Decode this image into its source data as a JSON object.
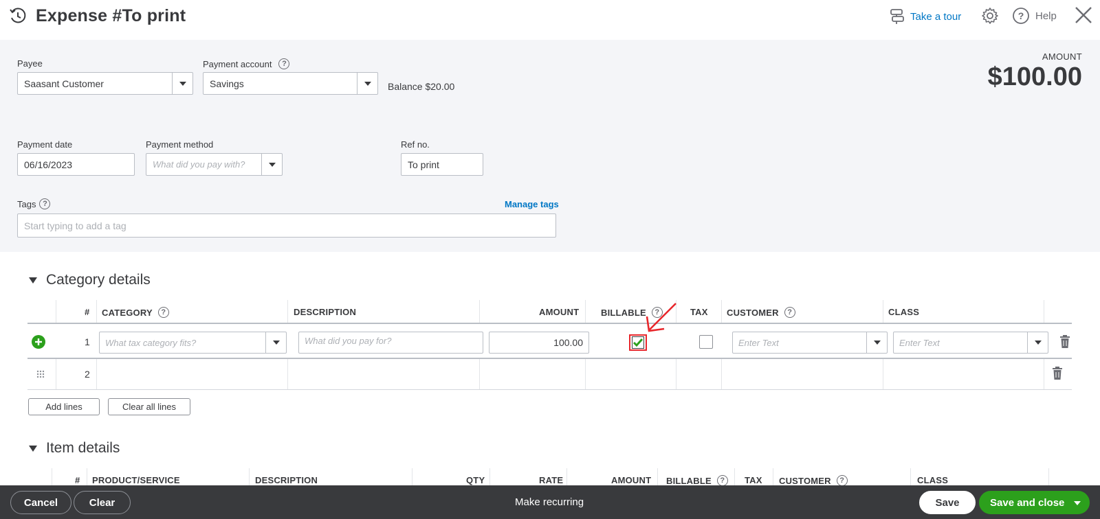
{
  "header": {
    "title": "Expense #To print",
    "take_tour": "Take a tour",
    "help": "Help"
  },
  "form": {
    "payee_label": "Payee",
    "payee_value": "Saasant Customer",
    "payment_account_label": "Payment account",
    "payment_account_value": "Savings",
    "balance_text": "Balance $20.00",
    "amount_label": "AMOUNT",
    "amount_value": "$100.00",
    "payment_date_label": "Payment date",
    "payment_date_value": "06/16/2023",
    "payment_method_label": "Payment method",
    "payment_method_placeholder": "What did you pay with?",
    "ref_no_label": "Ref no.",
    "ref_no_value": "To print",
    "tags_label": "Tags",
    "manage_tags": "Manage tags",
    "tags_placeholder": "Start typing to add a tag"
  },
  "category_details": {
    "title": "Category details",
    "columns": {
      "num": "#",
      "category": "CATEGORY",
      "description": "DESCRIPTION",
      "amount": "AMOUNT",
      "billable": "BILLABLE",
      "tax": "TAX",
      "customer": "CUSTOMER",
      "class": "CLASS"
    },
    "rows": [
      {
        "num": "1",
        "category_placeholder": "What tax category fits?",
        "description_placeholder": "What did you pay for?",
        "amount": "100.00",
        "billable": true,
        "tax": false,
        "customer_placeholder": "Enter Text",
        "class_placeholder": "Enter Text"
      },
      {
        "num": "2"
      }
    ],
    "add_lines": "Add lines",
    "clear_all_lines": "Clear all lines"
  },
  "item_details": {
    "title": "Item details",
    "columns": {
      "num": "#",
      "product": "PRODUCT/SERVICE",
      "description": "DESCRIPTION",
      "qty": "QTY",
      "rate": "RATE",
      "amount": "AMOUNT",
      "billable": "BILLABLE",
      "tax": "TAX",
      "customer": "CUSTOMER",
      "class": "CLASS"
    }
  },
  "footer": {
    "cancel": "Cancel",
    "clear": "Clear",
    "make_recurring": "Make recurring",
    "save": "Save",
    "save_and_close": "Save and close"
  },
  "colors": {
    "brand_green": "#2ca01c",
    "link_blue": "#0077c5",
    "footer_bg": "#393a3d",
    "annotation_red": "#e8262b"
  }
}
